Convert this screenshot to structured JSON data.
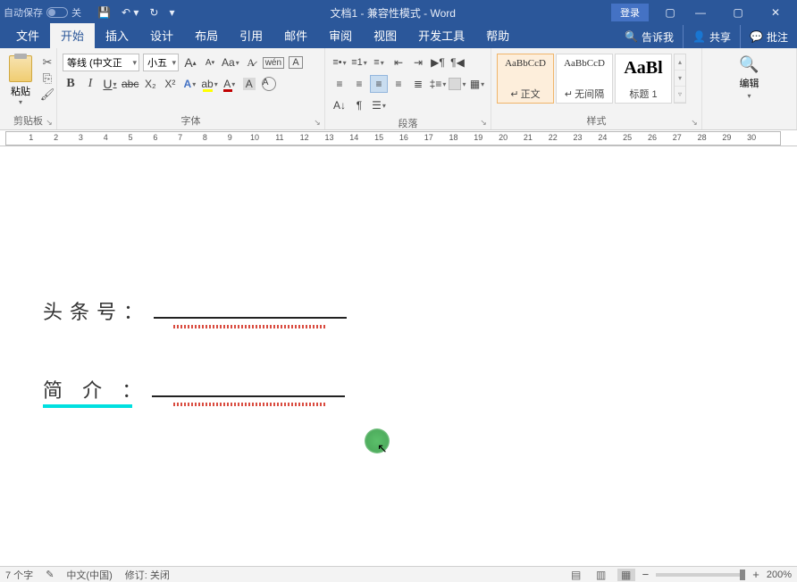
{
  "titlebar": {
    "autosave_label": "自动保存",
    "autosave_state": "关",
    "doc_title": "文档1 - 兼容性模式 - Word",
    "login": "登录"
  },
  "tabs": {
    "file": "文件",
    "home": "开始",
    "insert": "插入",
    "design": "设计",
    "layout": "布局",
    "references": "引用",
    "mailings": "邮件",
    "review": "审阅",
    "view": "视图",
    "developer": "开发工具",
    "help": "帮助",
    "tell_me": "告诉我",
    "share": "共享",
    "comments": "批注"
  },
  "ribbon": {
    "clipboard": {
      "paste": "粘贴",
      "label": "剪贴板"
    },
    "font": {
      "name": "等线 (中文正",
      "size": "小五",
      "label": "字体",
      "aa": "Aa",
      "wen": "wén",
      "a_enclose": "A",
      "char_border": "A",
      "b": "B",
      "i": "I",
      "u": "U",
      "abc": "abc",
      "x2": "X₂",
      "x2sup": "X²",
      "a_shade": "A",
      "a_hilite": "ab",
      "a_color": "A"
    },
    "paragraph": {
      "label": "段落"
    },
    "styles": {
      "label": "样式",
      "items": [
        {
          "preview": "AaBbCcD",
          "name": "正文",
          "marker": "↵"
        },
        {
          "preview": "AaBbCcD",
          "name": "无间隔",
          "marker": "↵"
        },
        {
          "preview": "AaBl",
          "name": "标题 1",
          "marker": ""
        }
      ]
    },
    "editing": {
      "label": "编辑"
    }
  },
  "document": {
    "line1_label": "头条号：",
    "line2_label": "简 介 ："
  },
  "statusbar": {
    "words": "7 个字",
    "lang": "中文(中国)",
    "track": "修订: 关闭",
    "zoom_pct": "200%"
  },
  "ruler": {
    "marks": [
      1,
      2,
      3,
      4,
      5,
      6,
      7,
      8,
      9,
      10,
      11,
      12,
      13,
      14,
      15,
      16,
      17,
      18,
      19,
      20,
      21,
      22,
      23,
      24,
      25,
      26,
      27,
      28,
      29,
      30
    ]
  }
}
